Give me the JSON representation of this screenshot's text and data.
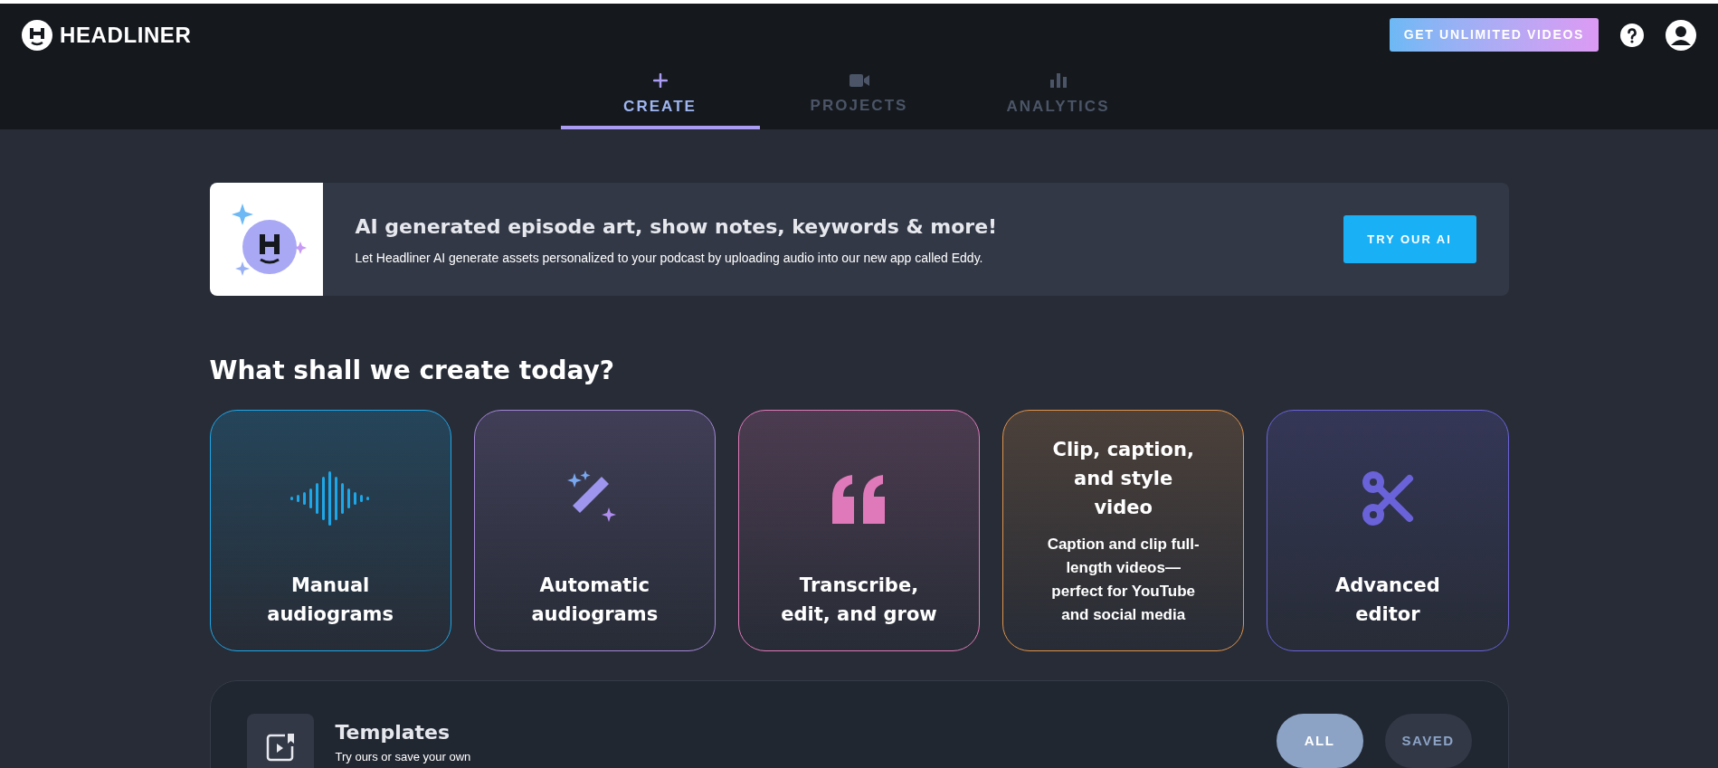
{
  "header": {
    "logo": "HEADLINER",
    "upgrade_button": "GET UNLIMITED VIDEOS"
  },
  "tabs": [
    {
      "label": "CREATE",
      "selected": true,
      "kind": "plus"
    },
    {
      "label": "PROJECTS",
      "selected": false,
      "kind": "camera"
    },
    {
      "label": "ANALYTICS",
      "selected": false,
      "kind": "chart"
    }
  ],
  "banner": {
    "title": "AI generated episode art, show notes, keywords & more!",
    "subtitle": "Let Headliner AI generate assets personalized to your podcast by uploading audio into our new app called Eddy.",
    "button": "TRY OUR AI"
  },
  "heading": "What shall we create today?",
  "cards": [
    {
      "kind": "waveform",
      "title": "Manual audiograms",
      "color": "#1ea7e8"
    },
    {
      "kind": "wand",
      "title": "Automatic audiograms",
      "color": "#a486d8"
    },
    {
      "kind": "quote",
      "title": "Transcribe, edit, and grow",
      "color": "#e079b9"
    },
    {
      "kind": "text",
      "title": "Clip, caption, and style video",
      "description": "Caption and clip full-length videos—perfect for YouTube and social media",
      "color": "#e0934a"
    },
    {
      "kind": "scissors",
      "title": "Advanced editor",
      "color": "#6a62d8"
    }
  ],
  "templates": {
    "title": "Templates",
    "subtitle": "Try ours or save your own",
    "filters": [
      {
        "label": "ALL",
        "selected": true
      },
      {
        "label": "SAVED",
        "selected": false
      }
    ]
  }
}
